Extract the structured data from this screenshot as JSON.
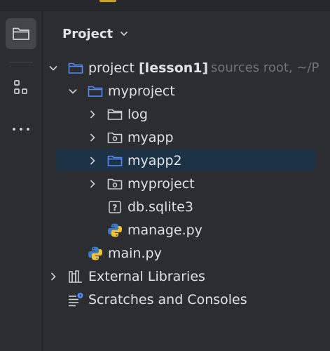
{
  "panel": {
    "title": "Project"
  },
  "tree": [
    {
      "label": "project",
      "branch": "[lesson1]",
      "hint": "sources root,  ~/P",
      "icon": "folder-icon"
    },
    {
      "label": "myproject",
      "icon": "folder-icon"
    },
    {
      "label": "log",
      "icon": "folder-icon"
    },
    {
      "label": "myapp",
      "icon": "package-icon"
    },
    {
      "label": "myapp2",
      "icon": "folder-icon"
    },
    {
      "label": "myproject",
      "icon": "package-icon"
    },
    {
      "label": "db.sqlite3",
      "icon": "unknown-file-icon"
    },
    {
      "label": "manage.py",
      "icon": "python-file-icon"
    },
    {
      "label": "main.py",
      "icon": "python-file-icon"
    },
    {
      "label": "External Libraries",
      "icon": "library-icon"
    },
    {
      "label": "Scratches and Consoles",
      "icon": "scratches-icon"
    }
  ],
  "colors": {
    "background": "#2b2d30",
    "selection": "#1e3246",
    "folder_blue": "#548af7",
    "text": "#dfe1e5",
    "hint": "#6f737a"
  }
}
